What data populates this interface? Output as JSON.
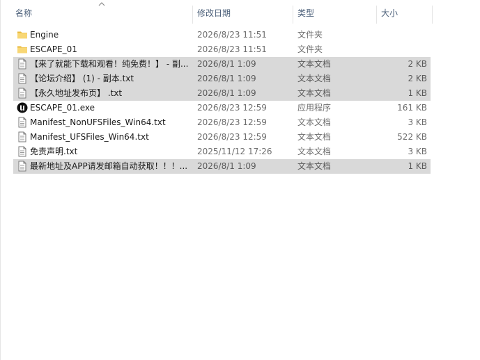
{
  "columns": {
    "name": "名称",
    "date": "修改日期",
    "type": "类型",
    "size": "大小"
  },
  "sort": {
    "column": "name",
    "direction": "ascending",
    "icon": "sort-up-chevron-icon"
  },
  "files": [
    {
      "name": "Engine",
      "date": "2026/8/23 11:51",
      "type": "文件夹",
      "size": "",
      "icon": "folder-icon",
      "selected": false
    },
    {
      "name": "ESCAPE_01",
      "date": "2026/8/23 11:51",
      "type": "文件夹",
      "size": "",
      "icon": "folder-icon",
      "selected": false
    },
    {
      "name": "【来了就能下载和观看！纯免费！】 - 副...",
      "date": "2026/8/1 1:09",
      "type": "文本文档",
      "size": "2 KB",
      "icon": "text-file-icon",
      "selected": true
    },
    {
      "name": "【论坛介绍】 (1) - 副本.txt",
      "date": "2026/8/1 1:09",
      "type": "文本文档",
      "size": "2 KB",
      "icon": "text-file-icon",
      "selected": true
    },
    {
      "name": "【永久地址发布页】 .txt",
      "date": "2026/8/1 1:09",
      "type": "文本文档",
      "size": "1 KB",
      "icon": "text-file-icon",
      "selected": true
    },
    {
      "name": "ESCAPE_01.exe",
      "date": "2026/8/23 12:59",
      "type": "应用程序",
      "size": "161 KB",
      "icon": "unreal-engine-icon",
      "selected": false
    },
    {
      "name": "Manifest_NonUFSFiles_Win64.txt",
      "date": "2026/8/23 12:59",
      "type": "文本文档",
      "size": "3 KB",
      "icon": "text-file-icon",
      "selected": false
    },
    {
      "name": "Manifest_UFSFiles_Win64.txt",
      "date": "2026/8/23 12:59",
      "type": "文本文档",
      "size": "522 KB",
      "icon": "text-file-icon",
      "selected": false
    },
    {
      "name": "免责声明.txt",
      "date": "2025/11/12 17:26",
      "type": "文本文档",
      "size": "3 KB",
      "icon": "text-file-icon",
      "selected": false
    },
    {
      "name": "最新地址及APP请发邮箱自动获取！！！...",
      "date": "2026/8/1 1:09",
      "type": "文本文档",
      "size": "1 KB",
      "icon": "text-file-icon",
      "selected": true
    }
  ],
  "colors": {
    "header_text": "#4c607a",
    "selection": "#d9d9d9",
    "folder": "#f8d775",
    "secondary_text": "#6d6d6d"
  }
}
